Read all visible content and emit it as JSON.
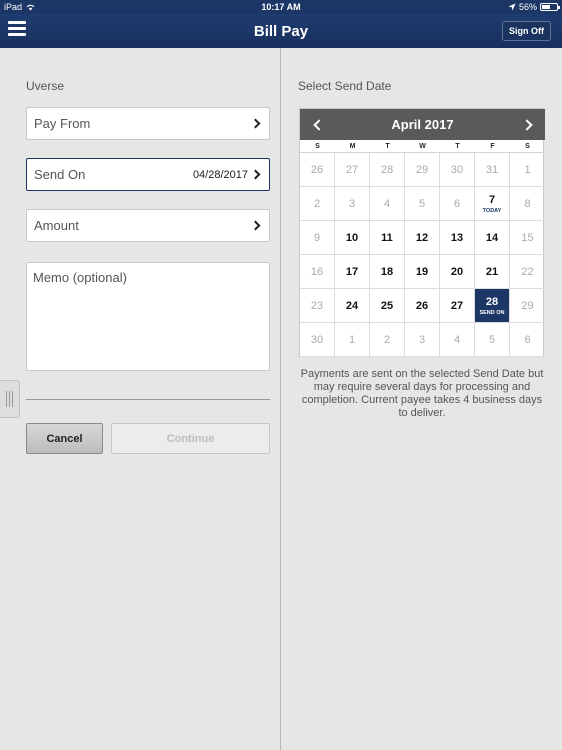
{
  "status_bar": {
    "device": "iPad",
    "time": "10:17 AM",
    "battery": "56%",
    "battery_level": 0.56
  },
  "nav": {
    "title": "Bill Pay",
    "sign_off": "Sign Off"
  },
  "left": {
    "payee": "Uverse",
    "pay_from_label": "Pay From",
    "send_on_label": "Send On",
    "send_on_value": "04/28/2017",
    "amount_label": "Amount",
    "memo_placeholder": "Memo (optional)",
    "cancel_label": "Cancel",
    "continue_label": "Continue"
  },
  "right": {
    "section_label": "Select Send Date",
    "calendar": {
      "month_label": "April 2017",
      "weekdays": [
        "S",
        "M",
        "T",
        "W",
        "T",
        "F",
        "S"
      ],
      "weeks": [
        [
          {
            "d": "26",
            "s": "muted"
          },
          {
            "d": "27",
            "s": "muted"
          },
          {
            "d": "28",
            "s": "muted"
          },
          {
            "d": "29",
            "s": "muted"
          },
          {
            "d": "30",
            "s": "muted"
          },
          {
            "d": "31",
            "s": "muted"
          },
          {
            "d": "1",
            "s": "muted"
          }
        ],
        [
          {
            "d": "2",
            "s": "muted"
          },
          {
            "d": "3",
            "s": "muted"
          },
          {
            "d": "4",
            "s": "muted"
          },
          {
            "d": "5",
            "s": "muted"
          },
          {
            "d": "6",
            "s": "muted"
          },
          {
            "d": "7",
            "s": "enabled today",
            "tag": "TODAY"
          },
          {
            "d": "8",
            "s": "muted"
          }
        ],
        [
          {
            "d": "9",
            "s": "muted"
          },
          {
            "d": "10",
            "s": "enabled"
          },
          {
            "d": "11",
            "s": "enabled"
          },
          {
            "d": "12",
            "s": "enabled"
          },
          {
            "d": "13",
            "s": "enabled"
          },
          {
            "d": "14",
            "s": "enabled"
          },
          {
            "d": "15",
            "s": "muted"
          }
        ],
        [
          {
            "d": "16",
            "s": "muted"
          },
          {
            "d": "17",
            "s": "enabled"
          },
          {
            "d": "18",
            "s": "enabled"
          },
          {
            "d": "19",
            "s": "enabled"
          },
          {
            "d": "20",
            "s": "enabled"
          },
          {
            "d": "21",
            "s": "enabled"
          },
          {
            "d": "22",
            "s": "muted"
          }
        ],
        [
          {
            "d": "23",
            "s": "muted"
          },
          {
            "d": "24",
            "s": "enabled"
          },
          {
            "d": "25",
            "s": "enabled"
          },
          {
            "d": "26",
            "s": "enabled"
          },
          {
            "d": "27",
            "s": "enabled"
          },
          {
            "d": "28",
            "s": "enabled selected",
            "tag": "SEND ON"
          },
          {
            "d": "29",
            "s": "muted"
          }
        ],
        [
          {
            "d": "30",
            "s": "muted"
          },
          {
            "d": "1",
            "s": "muted"
          },
          {
            "d": "2",
            "s": "muted"
          },
          {
            "d": "3",
            "s": "muted"
          },
          {
            "d": "4",
            "s": "muted"
          },
          {
            "d": "5",
            "s": "muted"
          },
          {
            "d": "6",
            "s": "muted"
          }
        ]
      ]
    },
    "note": "Payments are sent on the selected Send Date but may require several days for processing and completion. Current payee takes 4 business days to deliver."
  },
  "colors": {
    "nav_blue": "#1c3766",
    "selected_day": "#1c3766",
    "calendar_header": "#5a5a5a"
  },
  "icons": {
    "menu": "hamburger-menu-icon",
    "chevron": "chevron-right-icon",
    "wifi": "wifi-icon",
    "location": "location-arrow-icon",
    "battery": "battery-icon"
  }
}
